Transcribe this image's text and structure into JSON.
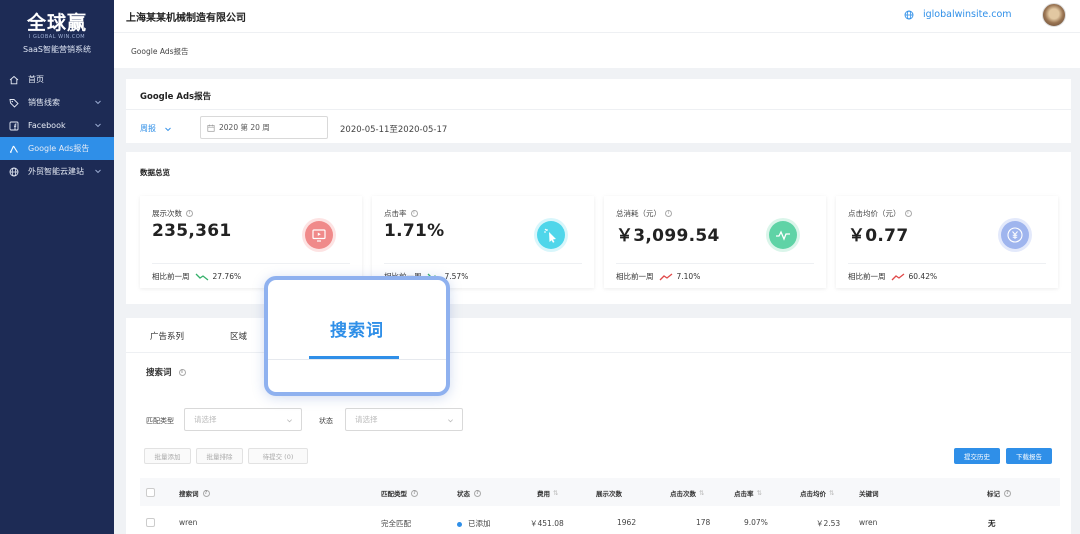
{
  "brand": {
    "logo": "全球赢",
    "sub": "I GLOBAL WIN.COM",
    "name": "SaaS智能营销系统"
  },
  "sidebar": {
    "items": [
      {
        "label": "首页",
        "icon": "home-icon",
        "active": false,
        "has_children": false
      },
      {
        "label": "销售线索",
        "icon": "tag-icon",
        "active": false,
        "has_children": true
      },
      {
        "label": "Facebook",
        "icon": "facebook-icon",
        "active": false,
        "has_children": true
      },
      {
        "label": "Google Ads报告",
        "icon": "google-ads-icon",
        "active": true,
        "has_children": false
      },
      {
        "label": "外贸智能云建站",
        "icon": "globe-icon",
        "active": false,
        "has_children": true
      }
    ]
  },
  "header": {
    "company": "上海某某机械制造有限公司",
    "site": "iglobalwinsite.com"
  },
  "breadcrumb": "Google Ads报告",
  "report": {
    "title": "Google Ads报告",
    "period": "周报",
    "week": "2020 第 20 周",
    "date_range": "2020-05-11至2020-05-17"
  },
  "overview": {
    "title": "数据总览",
    "compare_label": "相比前一周",
    "stats": [
      {
        "label": "展示次数",
        "value": "235,361",
        "change": "27.76%",
        "trend": "down",
        "icon": "monitor-icon",
        "color": "#f08a8a"
      },
      {
        "label": "点击率",
        "value": "1.71%",
        "change": "7.57%",
        "trend": "down",
        "icon": "click-icon",
        "color": "#4fd6ea"
      },
      {
        "label": "总消耗（元）",
        "value": "￥3,099.54",
        "change": "7.10%",
        "trend": "up",
        "icon": "pulse-icon",
        "color": "#5fd3a6"
      },
      {
        "label": "点击均价（元）",
        "value": "￥0.77",
        "change": "60.42%",
        "trend": "up",
        "icon": "yen-icon",
        "color": "#9fb5ee"
      }
    ]
  },
  "tabs": [
    "广告系列",
    "区域",
    "搜索词"
  ],
  "section": {
    "title": "搜索词"
  },
  "filters": {
    "match_label": "匹配类型",
    "match_placeholder": "请选择",
    "status_label": "状态",
    "status_placeholder": "请选择"
  },
  "actions": {
    "batch_add": "批量添加",
    "batch_remove": "批量排除",
    "selected": "待提交 (0)",
    "history": "提交历史",
    "download": "下载报告"
  },
  "table": {
    "headers": [
      "搜索词",
      "匹配类型",
      "状态",
      "费用",
      "展示次数",
      "点击次数",
      "点击率",
      "点击均价",
      "关键词",
      "标记"
    ],
    "rows": [
      {
        "term": "wren",
        "match": "完全匹配",
        "status": "已添加",
        "cost": "￥451.08",
        "impressions": "1962",
        "clicks": "178",
        "ctr": "9.07%",
        "cpc": "￥2.53",
        "keyword": "wren",
        "mark": "无"
      }
    ]
  },
  "popout": {
    "label": "搜索词"
  },
  "colors": {
    "accent": "#2f8fe8",
    "sidebar": "#1d2b55",
    "up": "#e04848",
    "down": "#35b06a"
  }
}
